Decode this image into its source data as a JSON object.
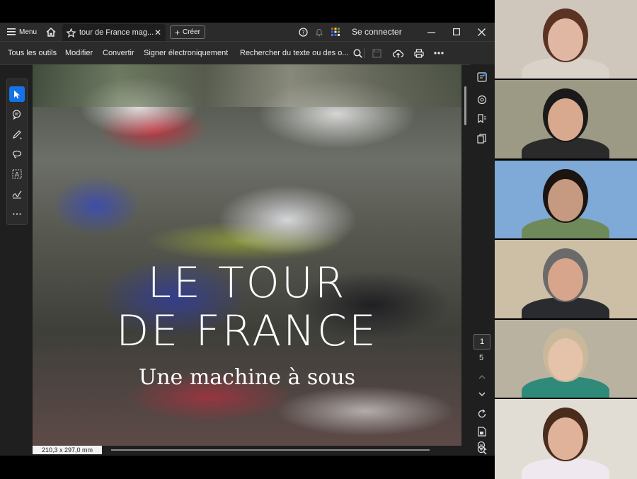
{
  "app": {
    "menu_label": "Menu",
    "tab_title": "tour de France mag...",
    "create_label": "Créer",
    "signin_label": "Se connecter",
    "toolbar": [
      "Tous les outils",
      "Modifier",
      "Convertir",
      "Signer électroniquement"
    ],
    "search_placeholder": "Rechercher du texte ou des o...",
    "accent_color": "#1473e6"
  },
  "document": {
    "cover_title_line1": "LE TOUR",
    "cover_title_line2": "DE FRANCE",
    "cover_subtitle": "Une machine à sous",
    "page_size": "210,3 x 297,0 mm",
    "current_page": "1",
    "total_pages": "5"
  },
  "icons": {
    "left_rail": [
      "select-arrow-icon",
      "comment-icon",
      "pen-icon",
      "lasso-icon",
      "text-box-icon",
      "sign-icon",
      "more-icon"
    ],
    "right_rail": [
      "edit-panel-icon",
      "comments-panel-icon",
      "bookmark-icon",
      "pages-icon",
      "scroll-up-icon",
      "scroll-down-icon",
      "rotate-icon",
      "page-fit-icon",
      "zoom-in-icon",
      "zoom-out-icon"
    ]
  },
  "participants": [
    {
      "name": "participant-1",
      "bg": "#cfc7bb",
      "skin": "#e0b7a3",
      "hair": "#5a3323",
      "shirt": "#d8d2c8"
    },
    {
      "name": "participant-2",
      "bg": "#9c9a84",
      "skin": "#d9a98f",
      "hair": "#1a1a1a",
      "shirt": "#2a2a2a"
    },
    {
      "name": "participant-3",
      "bg": "#7fa9d6",
      "skin": "#c69a80",
      "hair": "#1b1410",
      "shirt": "#6f8a5a"
    },
    {
      "name": "participant-4",
      "bg": "#cdbfa6",
      "skin": "#d7a58c",
      "hair": "#6a6a6a",
      "shirt": "#2a2b2f"
    },
    {
      "name": "participant-5",
      "bg": "#b9b2a0",
      "skin": "#e5c2aa",
      "hair": "#c9b89a",
      "shirt": "#2f8a7a"
    },
    {
      "name": "participant-6",
      "bg": "#e2ddd4",
      "skin": "#e0b29a",
      "hair": "#4a2c1c",
      "shirt": "#efe8ee"
    }
  ]
}
